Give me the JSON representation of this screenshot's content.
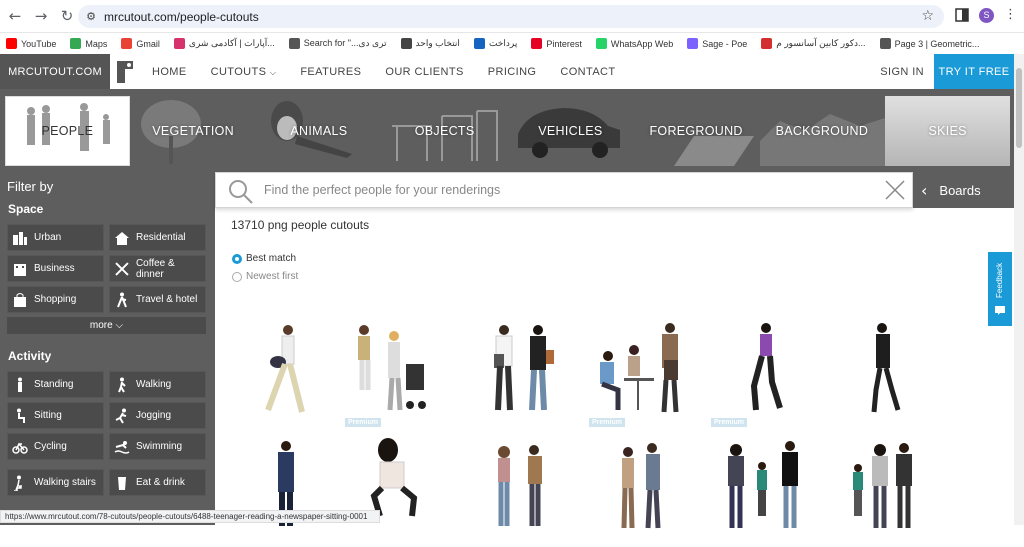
{
  "browser": {
    "url": "mrcutout.com/people-cutouts",
    "bookmarks": [
      "YouTube",
      "Maps",
      "Gmail",
      "آپارات | آکادمی شری...",
      "Search for \"...ترى دى",
      "انتخاب واحد",
      "پرداخت",
      "Pinterest",
      "WhatsApp Web",
      "Sage - Poe",
      "دکور کابین آسانسور م...",
      "Page 3 | Geometric..."
    ],
    "bookmark_colors": [
      "#ff0000",
      "#34a853",
      "#ea4335",
      "#d6336c",
      "#555555",
      "#444444",
      "#1565c0",
      "#e60023",
      "#25d366",
      "#7b61ff",
      "#d32f2f",
      "#555555"
    ],
    "profile_initial": "S",
    "status_url": "https://www.mrcutout.com/78-cutouts/people-cutouts/6488-teenager-reading-a-newspaper-sitting-0001"
  },
  "site": {
    "logo": "MRCUTOUT.COM",
    "nav": [
      "HOME",
      "CUTOUTS",
      "FEATURES",
      "OUR CLIENTS",
      "PRICING",
      "CONTACT"
    ],
    "signin": "SIGN IN",
    "try": "TRY IT FREE",
    "accent": "#1a9ad7"
  },
  "categories": [
    "PEOPLE",
    "VEGETATION",
    "ANIMALS",
    "OBJECTS",
    "VEHICLES",
    "FOREGROUND",
    "BACKGROUND",
    "SKIES"
  ],
  "sidebar": {
    "title": "Filter by",
    "space_heading": "Space",
    "space": [
      "Urban",
      "Residential",
      "Business",
      "Coffee & dinner",
      "Shopping",
      "Travel & hotel"
    ],
    "more": "more",
    "activity_heading": "Activity",
    "activity": [
      "Standing",
      "Walking",
      "Sitting",
      "Jogging",
      "Cycling",
      "Swimming",
      "Walking stairs",
      "Eat & drink"
    ]
  },
  "search": {
    "placeholder": "Find the perfect people for your renderings",
    "boards": "Boards"
  },
  "results": {
    "count": "13710 png people cutouts",
    "sort": [
      "Best match",
      "Newest first"
    ],
    "sort_selected": "Best match",
    "badge": "Premium"
  },
  "feedback": "Feedback"
}
